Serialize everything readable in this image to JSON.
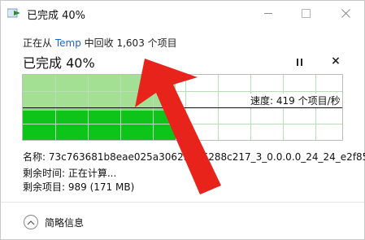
{
  "titlebar": {
    "title": "已完成 40%",
    "icons": [
      "file-transfer-icon",
      "minimize-icon",
      "maximize-icon",
      "close-icon"
    ]
  },
  "operation": {
    "prefix": "正在从",
    "source": "Temp",
    "suffix": "中回收 1,603 个项目",
    "link_color": "#1a67c7"
  },
  "progress": {
    "heading": "已完成 40%",
    "percent": 40,
    "fill_color": "#0ec41b",
    "speed_label": "速度: 419 个项目/秒"
  },
  "controls": {
    "pause_icon": "pause-icon",
    "cancel_label": "×"
  },
  "details": {
    "name_line": "名称: 73c763681b8eae025a30623535288c217_3_0.0.0.0_24_24_e2f85...",
    "time_line": "剩余时间: 正在计算...",
    "items_line": "剩余项目: 989 (171 MB)"
  },
  "footer": {
    "less_details": "简略信息"
  },
  "annotation": {
    "color": "#e8231b"
  }
}
